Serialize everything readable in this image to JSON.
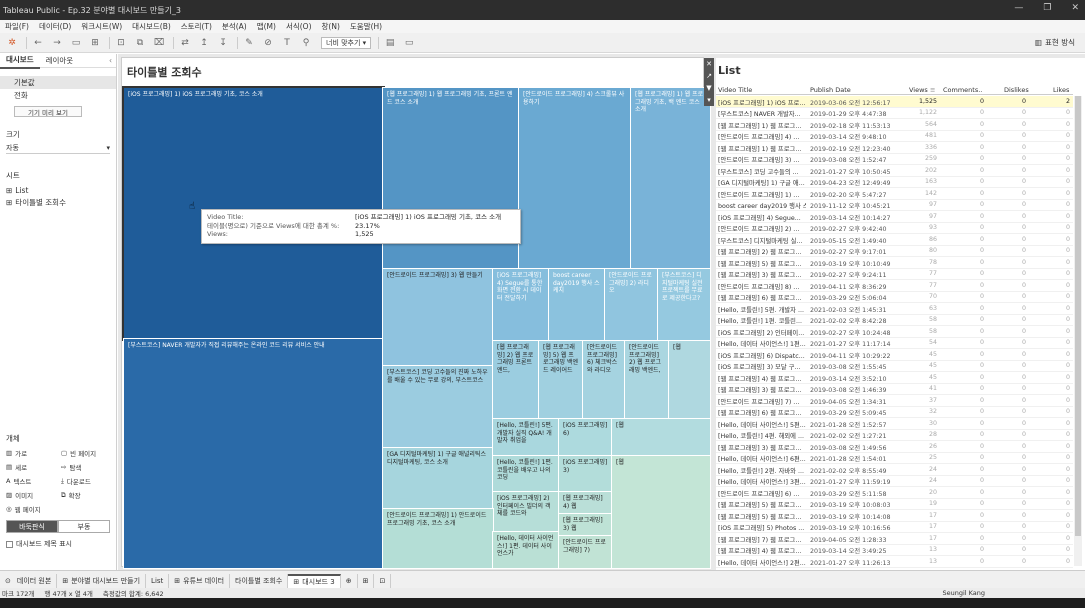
{
  "window": {
    "title": "Tableau Public - Ep.32 분야별 대시보드 만들기_3",
    "controls": [
      "—",
      "❐",
      "✕"
    ]
  },
  "menu": [
    "파일(F)",
    "데이터(D)",
    "워크시트(W)",
    "대시보드(B)",
    "스토리(T)",
    "분석(A)",
    "맵(M)",
    "서식(O)",
    "창(N)",
    "도움말(H)"
  ],
  "toolbar": {
    "fit_label": "너비 맞추기",
    "show_me": "표현 방식"
  },
  "left_panel": {
    "tabs": [
      "대시보드",
      "레이아웃"
    ],
    "device_items": [
      "기본값",
      "전화"
    ],
    "preview_btn": "기기 미리 보기",
    "size_header": "크기",
    "size_value": "자동",
    "sheets_header": "시트",
    "sheets": [
      "List",
      "타이틀별 조회수"
    ],
    "objects_header": "개체",
    "objects": [
      "가로",
      "빈 페이지",
      "세로",
      "탐색",
      "텍스트",
      "다운로드",
      "이미지",
      "확장",
      "웹 페이지"
    ],
    "layout_btns": [
      "바둑판식",
      "부동"
    ],
    "show_title": "대시보드 제목 표시"
  },
  "treemap": {
    "title": "타이틀별 조회수",
    "boxes": [
      "[iOS 프로그래밍] 1) iOS 프로그래밍 기초, 코스 소개",
      "[부스트코스] NAVER 개발자가 직접 리뷰해주는 온라인 코드 리뷰 서비스 안내",
      "[웹 프로그래밍] 1) 웹 프로그래밍 기초, 프론트 엔드 코스 소개",
      "[안드로이드 프로그래밍] 4) 스크롤뷰 사용하기",
      "[웹 프로그래밍] 1) 웹 프로그래밍 기초, 백 엔드 코스 소개",
      "[안드로이드 프로그래밍] 3) 웹 만들기",
      "[iOS 프로그래밍] 4) Segue를 통한 화면 전환 시 데이터 전달하기",
      "boost career day2019 행사 스케치",
      "[안드로이드 프로그래밍] 2) 라디오",
      "[부스트코스] 디지털마케팅 실전 프로젝트를 무료로 제공한다고?",
      "[부스트코스] 코딩 고수들의 진짜 노하우를 배울 수 있는 무료 강의, 부스트코스",
      "[웹 프로그래밍] 2) 웹 프로그래밍 프론트 엔드,",
      "[웹 프로그래밍] 5) 웹 프로그래밍 백엔드 레이어드",
      "[안드로이드 프로그래밍] 6) 체크박스와 라디오",
      "[안드로이드 프로그래밍] 2) 웹 프로그래밍 백엔드,",
      "[웹",
      "[GA 디지털마케팅] 1) 구글 애널리틱스 디지털마케팅, 코스 소개",
      "[Hello, 코틀린!] 5편. 개발자 실직 Q&A! 개발자 취업을",
      "[iOS 프로그래밍] 6)",
      "[웹",
      "[Hello, 코틀린!] 1편. 코틀린을 배우고 나의 코딩",
      "[iOS 프로그래밍] 3)",
      "[iOS 프로그래밍] 2) 인터페이스 빌더의 객체를 코드와",
      "[웹 프로그래밍] 4) 웹",
      "[안드로이드 프로그래밍] 1) 안드로이드 프로그래밍 기초, 코스 소개",
      "[Hello, 데이터 사이언스!] 1편. 데이터 사이언스가",
      "[웹 프로그래밍] 3) 웹",
      "[안드로이드 프로그래밍] 7)",
      "[웹"
    ]
  },
  "tooltip": {
    "rows": [
      {
        "k": "Video Title:",
        "v": "[iOS 프로그래밍] 1) iOS 프로그래밍 기초, 코스 소개"
      },
      {
        "k": "테이블(명으로) 기준으로 Views에 대한 총계 %:",
        "v": "23.17%"
      },
      {
        "k": "Views:",
        "v": "1,525"
      }
    ]
  },
  "list": {
    "title": "List",
    "headers": [
      "Video Title",
      "Publish Date",
      "Views",
      "Comments..",
      "Dislikes",
      "Likes"
    ],
    "rows": [
      [
        "[iOS 프로그래밍] 1) iOS 프로...",
        "2019-03-06 오전 12:56:17",
        "1,525",
        "0",
        "0",
        "2"
      ],
      [
        "[부스트코스] NAVER 개발자...",
        "2019-01-29 오후 4:47:38",
        "1,122",
        "0",
        "0",
        "0"
      ],
      [
        "[웹 프로그래밍] 1) 웹 프로그...",
        "2019-02-18 오후 11:53:13",
        "564",
        "0",
        "0",
        "0"
      ],
      [
        "[안드로이드 프로그래밍] 4) ...",
        "2019-03-14 오전 9:48:10",
        "481",
        "0",
        "0",
        "0"
      ],
      [
        "[웹 프로그래밍] 1) 웹 프로그...",
        "2019-02-19 오전 12:23:40",
        "336",
        "0",
        "0",
        "0"
      ],
      [
        "[안드로이드 프로그래밍] 3) ...",
        "2019-03-08 오전 1:52:47",
        "259",
        "0",
        "0",
        "0"
      ],
      [
        "[부스트코스] 코딩 고수들의 ...",
        "2021-01-27 오후 10:50:45",
        "202",
        "0",
        "0",
        "0"
      ],
      [
        "[GA 디지털마케팅] 1) 구글 애...",
        "2019-04-23 오전 12:49:49",
        "163",
        "0",
        "0",
        "0"
      ],
      [
        "[안드로이드 프로그래밍] 1) ...",
        "2019-02-20 오후 5:47:27",
        "142",
        "0",
        "0",
        "0"
      ],
      [
        "boost career day2019 행사 스...",
        "2019-11-12 오후 10:45:21",
        "97",
        "0",
        "0",
        "0"
      ],
      [
        "[iOS 프로그래밍] 4) Segue...",
        "2019-03-14 오전 10:14:27",
        "97",
        "0",
        "0",
        "0"
      ],
      [
        "[안드로이드 프로그래밍] 2) ...",
        "2019-02-27 오후 9:42:40",
        "93",
        "0",
        "0",
        "0"
      ],
      [
        "[부스트코스] 디지털마케팅 실...",
        "2019-05-15 오전 1:49:40",
        "86",
        "0",
        "0",
        "0"
      ],
      [
        "[웹 프로그래밍] 2) 웹 프로그...",
        "2019-02-27 오후 9:17:01",
        "80",
        "0",
        "0",
        "0"
      ],
      [
        "[웹 프로그래밍] 5) 웹 프로그...",
        "2019-03-19 오후 10:10:49",
        "78",
        "0",
        "0",
        "0"
      ],
      [
        "[웹 프로그래밍] 3) 웹 프로그...",
        "2019-02-27 오후 9:24:11",
        "77",
        "0",
        "0",
        "0"
      ],
      [
        "[안드로이드 프로그래밍] 8) ...",
        "2019-04-11 오후 8:36:29",
        "77",
        "0",
        "0",
        "0"
      ],
      [
        "[웹 프로그래밍] 6) 웹 프로그...",
        "2019-03-29 오전 5:06:04",
        "70",
        "0",
        "0",
        "0"
      ],
      [
        "[Hello, 코틀린!] 5편. 개발자 ...",
        "2021-02-03 오전 1:45:31",
        "63",
        "0",
        "0",
        "0"
      ],
      [
        "[Hello, 코틀린!] 1편. 코틀린...",
        "2021-02-02 오후 8:42:28",
        "58",
        "0",
        "0",
        "0"
      ],
      [
        "[iOS 프로그래밍] 2) 인터페이...",
        "2019-02-27 오후 10:24:48",
        "58",
        "0",
        "0",
        "0"
      ],
      [
        "[Hello, 데이터 사이언스!] 1편...",
        "2021-01-27 오후 11:17:14",
        "54",
        "0",
        "0",
        "0"
      ],
      [
        "[iOS 프로그래밍] 6) Dispatc...",
        "2019-04-11 오후 10:29:22",
        "45",
        "0",
        "0",
        "0"
      ],
      [
        "[iOS 프로그래밍] 3) 모달 구...",
        "2019-03-08 오전 1:55:45",
        "45",
        "0",
        "0",
        "0"
      ],
      [
        "[웹 프로그래밍] 4) 웹 프로그...",
        "2019-03-14 오전 3:52:10",
        "45",
        "0",
        "0",
        "0"
      ],
      [
        "[웹 프로그래밍] 3) 웹 프로그...",
        "2019-03-08 오전 1:46:39",
        "41",
        "0",
        "0",
        "0"
      ],
      [
        "[안드로이드 프로그래밍] 7) ...",
        "2019-04-05 오전 1:34:31",
        "37",
        "0",
        "0",
        "0"
      ],
      [
        "[웹 프로그래밍] 6) 웹 프로그...",
        "2019-03-29 오전 5:09:45",
        "32",
        "0",
        "0",
        "0"
      ],
      [
        "[Hello, 데이터 사이언스!] 5편...",
        "2021-01-28 오전 1:52:57",
        "30",
        "0",
        "0",
        "0"
      ],
      [
        "[Hello, 코틀린!] 4편. 해외에 ...",
        "2021-02-02 오전 1:27:21",
        "28",
        "0",
        "0",
        "0"
      ],
      [
        "[웹 프로그래밍] 3) 웹 프로그...",
        "2019-03-08 오전 1:49:56",
        "26",
        "0",
        "0",
        "0"
      ],
      [
        "[Hello, 데이터 사이언스!] 6편...",
        "2021-01-28 오전 1:54:01",
        "25",
        "0",
        "0",
        "0"
      ],
      [
        "[Hello, 코틀린!] 2편. 자바와 ...",
        "2021-02-02 오후 8:55:49",
        "24",
        "0",
        "0",
        "0"
      ],
      [
        "[Hello, 데이터 사이언스!] 3편...",
        "2021-01-27 오후 11:59:19",
        "24",
        "0",
        "0",
        "0"
      ],
      [
        "[안드로이드 프로그래밍] 6) ...",
        "2019-03-29 오전 5:11:58",
        "20",
        "0",
        "0",
        "0"
      ],
      [
        "[웹 프로그래밍] 5) 웹 프로그...",
        "2019-03-19 오후 10:08:03",
        "19",
        "0",
        "0",
        "0"
      ],
      [
        "[웹 프로그래밍] 5) 웹 프로그...",
        "2019-03-19 오후 10:14:08",
        "17",
        "0",
        "0",
        "0"
      ],
      [
        "[iOS 프로그래밍] 5) Photos ...",
        "2019-03-19 오후 10:16:56",
        "17",
        "0",
        "0",
        "0"
      ],
      [
        "[웹 프로그래밍] 7) 웹 프로그...",
        "2019-04-05 오전 1:28:33",
        "17",
        "0",
        "0",
        "0"
      ],
      [
        "[웹 프로그래밍] 4) 웹 프로그...",
        "2019-03-14 오전 3:49:25",
        "13",
        "0",
        "0",
        "0"
      ],
      [
        "[Hello, 데이터 사이언스!] 2편...",
        "2021-01-27 오후 11:26:13",
        "13",
        "0",
        "0",
        "0"
      ]
    ]
  },
  "sheet_tabs": [
    "데이터 원본",
    "분야별 대시보드 만들기",
    "List",
    "유튜브 데이터",
    "타이틀별 조회수",
    "대시보드 3"
  ],
  "footer": {
    "marks": "마크 172개",
    "rows": "행 47개 x 열 4개",
    "sum": "측정값의 합계: 6,642",
    "user": "Seungil Kang"
  }
}
